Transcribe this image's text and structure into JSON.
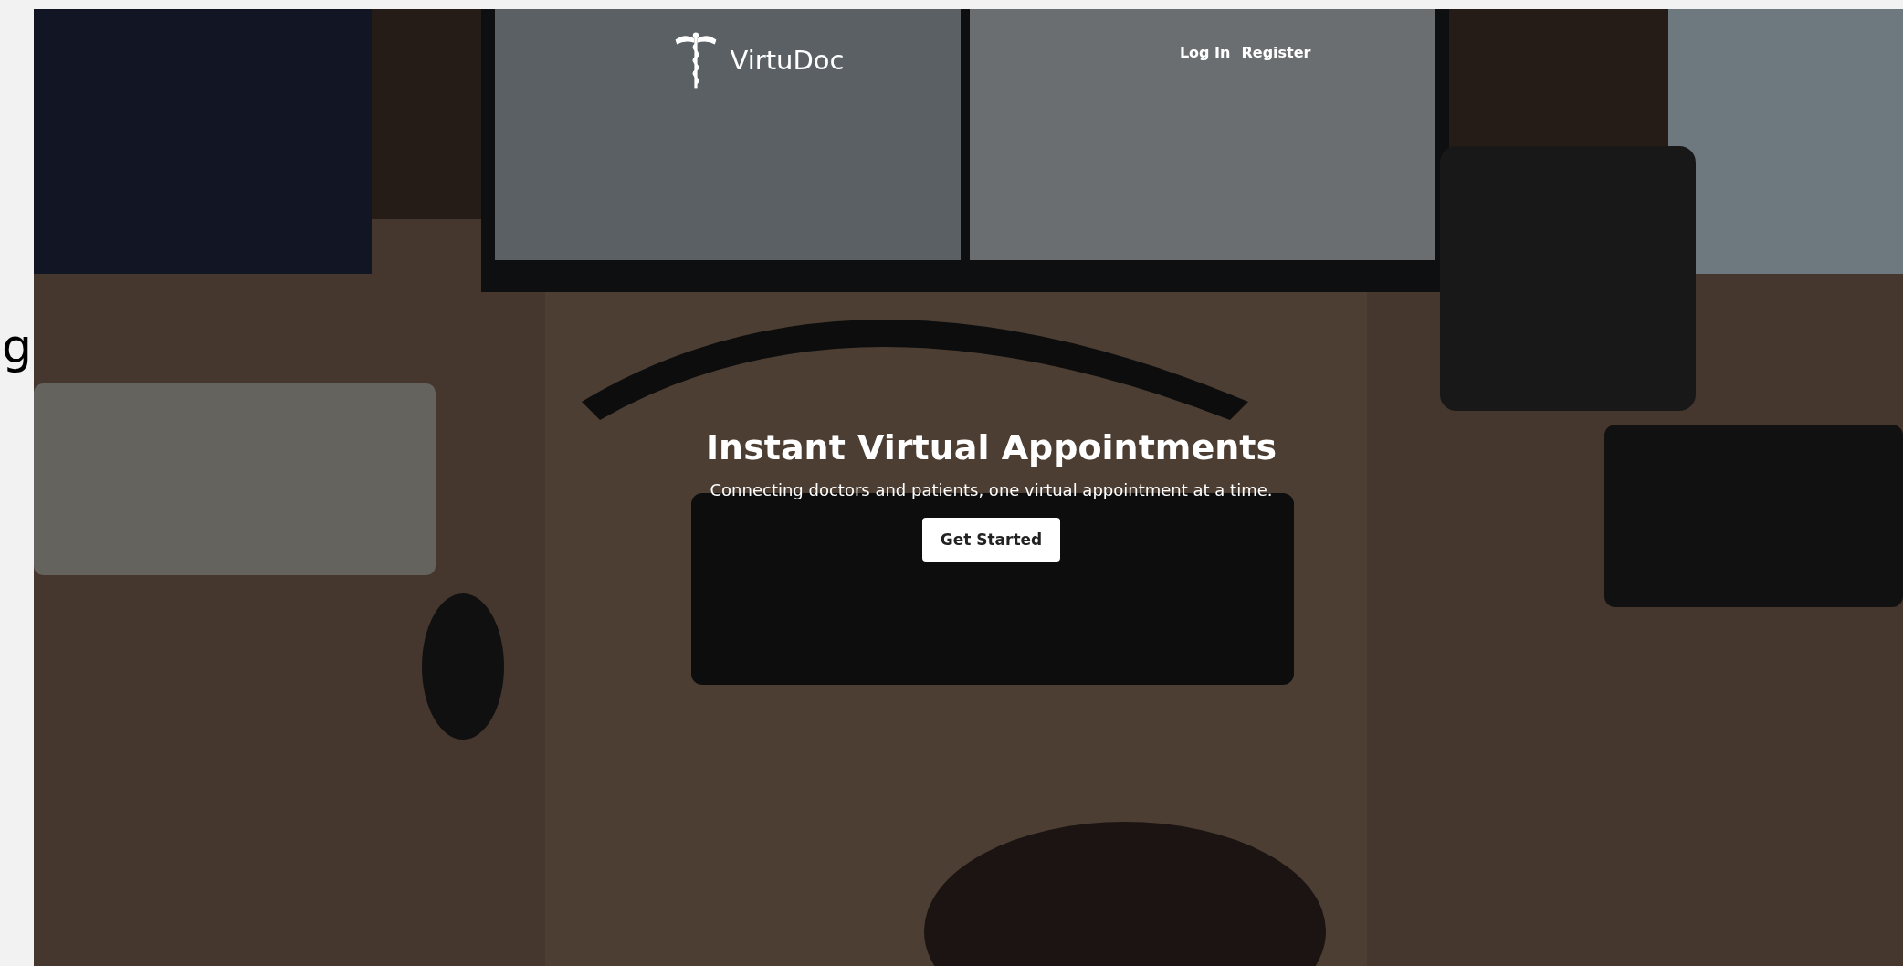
{
  "side_text": "g",
  "nav": {
    "brand": "VirtuDoc",
    "links": [
      {
        "label": "Log In"
      },
      {
        "label": "Register"
      }
    ]
  },
  "hero": {
    "title": "Instant Virtual Appointments",
    "subtitle": "Connecting doctors and patients, one virtual appointment at a time.",
    "button": "Get Started"
  }
}
